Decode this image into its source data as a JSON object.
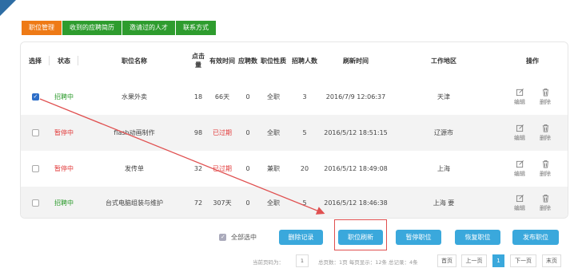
{
  "tabs": [
    {
      "label": "职位管理",
      "active": true
    },
    {
      "label": "收到的应聘简历",
      "active": false
    },
    {
      "label": "邀请过的人才",
      "active": false
    },
    {
      "label": "联系方式",
      "active": false
    }
  ],
  "table": {
    "headers": {
      "select": "选择",
      "status": "状态",
      "name": "职位名称",
      "clicks": "点击量",
      "valid": "有效时间",
      "applicants": "应聘数",
      "type": "职位性质",
      "count": "招聘人数",
      "time": "刷新时间",
      "area": "工作地区",
      "ops": "操作"
    },
    "rows": [
      {
        "checked": true,
        "status": "招聘中",
        "status_color": "#2a9a2a",
        "name": "水果外卖",
        "clicks": "18",
        "valid": "66天",
        "valid_color": "#444444",
        "applicants": "0",
        "type": "全职",
        "count": "3",
        "time": "2016/7/9 12:06:37",
        "area": "天津"
      },
      {
        "checked": false,
        "status": "暂停中",
        "status_color": "#e23b3b",
        "name": "flash动画制作",
        "clicks": "98",
        "valid": "已过期",
        "valid_color": "#e23b3b",
        "applicants": "0",
        "type": "全职",
        "count": "5",
        "time": "2016/5/12 18:51:15",
        "area": "辽源市"
      },
      {
        "checked": false,
        "status": "暂停中",
        "status_color": "#e23b3b",
        "name": "发传单",
        "clicks": "32",
        "valid": "已过期",
        "valid_color": "#e23b3b",
        "applicants": "0",
        "type": "兼职",
        "count": "20",
        "time": "2016/5/12 18:49:08",
        "area": "上海"
      },
      {
        "checked": false,
        "status": "招聘中",
        "status_color": "#2a9a2a",
        "name": "台式电脑组装与维护",
        "clicks": "72",
        "valid": "307天",
        "valid_color": "#444444",
        "applicants": "0",
        "type": "全职",
        "count": "5",
        "time": "2016/5/12 18:46:38",
        "area": "上海 要"
      }
    ],
    "op_edit": "编辑",
    "op_delete": "删除"
  },
  "actions": {
    "select_all": "全部选中",
    "delete_records": "删除记录",
    "refresh": "职位刷新",
    "pause": "暂停职位",
    "restore": "恢复职位",
    "publish": "发布职位"
  },
  "pager": {
    "current_label": "当前页码为：",
    "current_page": "1",
    "summary": "总页数：1页 每页显示：12条 总记录：4条",
    "first": "首页",
    "prev": "上一页",
    "current": "1",
    "next": "下一页",
    "last": "末页"
  },
  "colors": {
    "tab_active": "#ee7a16",
    "tab_normal": "#2e9c2e",
    "button": "#3aa8dc",
    "annotation": "#e05050"
  }
}
